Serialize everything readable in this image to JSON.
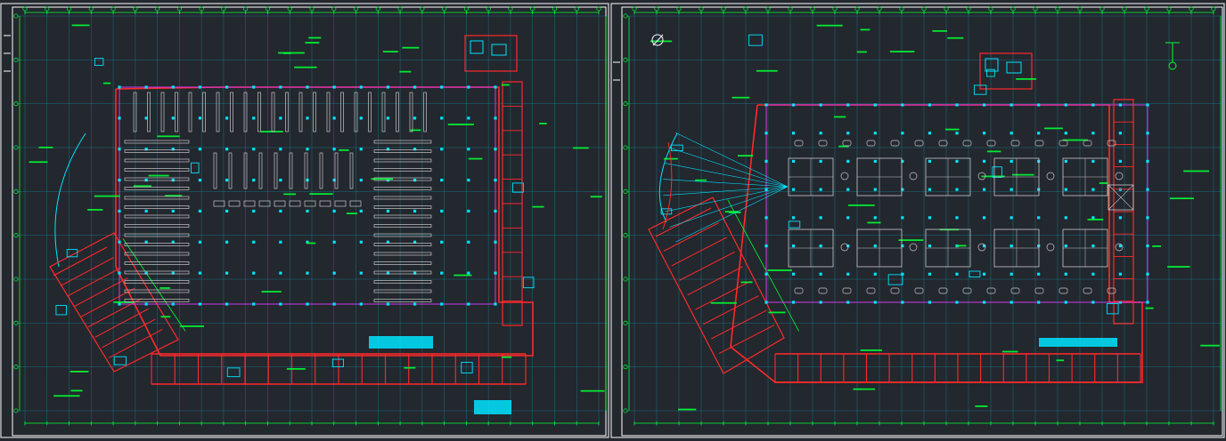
{
  "drawing": {
    "background": "#23272e",
    "colors": {
      "wall": "#ff2a2a",
      "grid": "#00e5ff",
      "annotation": "#00ff33",
      "frame": "#ffffff",
      "boundary": "#e040ff",
      "fixture": "#c8c8c8",
      "column": "#00e5ff"
    },
    "left_sheet": {
      "name": "left-floor-plan",
      "center_label": "",
      "grid_cols": 26,
      "grid_rows": 9
    },
    "right_sheet": {
      "name": "right-floor-plan",
      "center_label": "",
      "grid_cols": 26,
      "grid_rows": 9
    },
    "title_block": "",
    "north_symbol": "north-arrow-icon"
  }
}
